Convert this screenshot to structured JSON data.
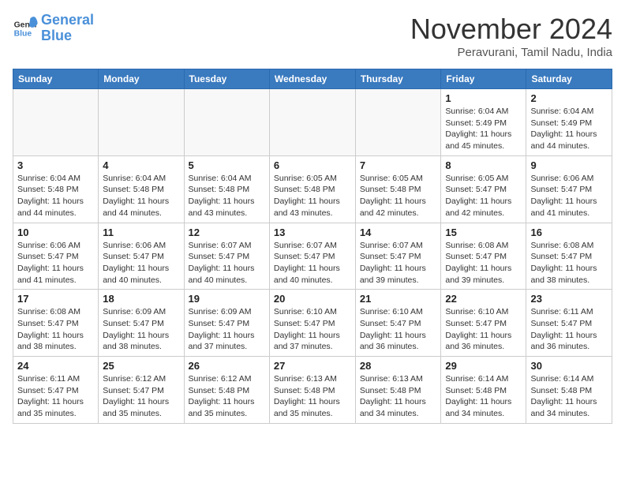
{
  "header": {
    "logo_line1": "General",
    "logo_line2": "Blue",
    "month": "November 2024",
    "location": "Peravurani, Tamil Nadu, India"
  },
  "weekdays": [
    "Sunday",
    "Monday",
    "Tuesday",
    "Wednesday",
    "Thursday",
    "Friday",
    "Saturday"
  ],
  "weeks": [
    [
      {
        "day": "",
        "info": ""
      },
      {
        "day": "",
        "info": ""
      },
      {
        "day": "",
        "info": ""
      },
      {
        "day": "",
        "info": ""
      },
      {
        "day": "",
        "info": ""
      },
      {
        "day": "1",
        "info": "Sunrise: 6:04 AM\nSunset: 5:49 PM\nDaylight: 11 hours and 45 minutes."
      },
      {
        "day": "2",
        "info": "Sunrise: 6:04 AM\nSunset: 5:49 PM\nDaylight: 11 hours and 44 minutes."
      }
    ],
    [
      {
        "day": "3",
        "info": "Sunrise: 6:04 AM\nSunset: 5:48 PM\nDaylight: 11 hours and 44 minutes."
      },
      {
        "day": "4",
        "info": "Sunrise: 6:04 AM\nSunset: 5:48 PM\nDaylight: 11 hours and 44 minutes."
      },
      {
        "day": "5",
        "info": "Sunrise: 6:04 AM\nSunset: 5:48 PM\nDaylight: 11 hours and 43 minutes."
      },
      {
        "day": "6",
        "info": "Sunrise: 6:05 AM\nSunset: 5:48 PM\nDaylight: 11 hours and 43 minutes."
      },
      {
        "day": "7",
        "info": "Sunrise: 6:05 AM\nSunset: 5:48 PM\nDaylight: 11 hours and 42 minutes."
      },
      {
        "day": "8",
        "info": "Sunrise: 6:05 AM\nSunset: 5:47 PM\nDaylight: 11 hours and 42 minutes."
      },
      {
        "day": "9",
        "info": "Sunrise: 6:06 AM\nSunset: 5:47 PM\nDaylight: 11 hours and 41 minutes."
      }
    ],
    [
      {
        "day": "10",
        "info": "Sunrise: 6:06 AM\nSunset: 5:47 PM\nDaylight: 11 hours and 41 minutes."
      },
      {
        "day": "11",
        "info": "Sunrise: 6:06 AM\nSunset: 5:47 PM\nDaylight: 11 hours and 40 minutes."
      },
      {
        "day": "12",
        "info": "Sunrise: 6:07 AM\nSunset: 5:47 PM\nDaylight: 11 hours and 40 minutes."
      },
      {
        "day": "13",
        "info": "Sunrise: 6:07 AM\nSunset: 5:47 PM\nDaylight: 11 hours and 40 minutes."
      },
      {
        "day": "14",
        "info": "Sunrise: 6:07 AM\nSunset: 5:47 PM\nDaylight: 11 hours and 39 minutes."
      },
      {
        "day": "15",
        "info": "Sunrise: 6:08 AM\nSunset: 5:47 PM\nDaylight: 11 hours and 39 minutes."
      },
      {
        "day": "16",
        "info": "Sunrise: 6:08 AM\nSunset: 5:47 PM\nDaylight: 11 hours and 38 minutes."
      }
    ],
    [
      {
        "day": "17",
        "info": "Sunrise: 6:08 AM\nSunset: 5:47 PM\nDaylight: 11 hours and 38 minutes."
      },
      {
        "day": "18",
        "info": "Sunrise: 6:09 AM\nSunset: 5:47 PM\nDaylight: 11 hours and 38 minutes."
      },
      {
        "day": "19",
        "info": "Sunrise: 6:09 AM\nSunset: 5:47 PM\nDaylight: 11 hours and 37 minutes."
      },
      {
        "day": "20",
        "info": "Sunrise: 6:10 AM\nSunset: 5:47 PM\nDaylight: 11 hours and 37 minutes."
      },
      {
        "day": "21",
        "info": "Sunrise: 6:10 AM\nSunset: 5:47 PM\nDaylight: 11 hours and 36 minutes."
      },
      {
        "day": "22",
        "info": "Sunrise: 6:10 AM\nSunset: 5:47 PM\nDaylight: 11 hours and 36 minutes."
      },
      {
        "day": "23",
        "info": "Sunrise: 6:11 AM\nSunset: 5:47 PM\nDaylight: 11 hours and 36 minutes."
      }
    ],
    [
      {
        "day": "24",
        "info": "Sunrise: 6:11 AM\nSunset: 5:47 PM\nDaylight: 11 hours and 35 minutes."
      },
      {
        "day": "25",
        "info": "Sunrise: 6:12 AM\nSunset: 5:47 PM\nDaylight: 11 hours and 35 minutes."
      },
      {
        "day": "26",
        "info": "Sunrise: 6:12 AM\nSunset: 5:48 PM\nDaylight: 11 hours and 35 minutes."
      },
      {
        "day": "27",
        "info": "Sunrise: 6:13 AM\nSunset: 5:48 PM\nDaylight: 11 hours and 35 minutes."
      },
      {
        "day": "28",
        "info": "Sunrise: 6:13 AM\nSunset: 5:48 PM\nDaylight: 11 hours and 34 minutes."
      },
      {
        "day": "29",
        "info": "Sunrise: 6:14 AM\nSunset: 5:48 PM\nDaylight: 11 hours and 34 minutes."
      },
      {
        "day": "30",
        "info": "Sunrise: 6:14 AM\nSunset: 5:48 PM\nDaylight: 11 hours and 34 minutes."
      }
    ]
  ]
}
